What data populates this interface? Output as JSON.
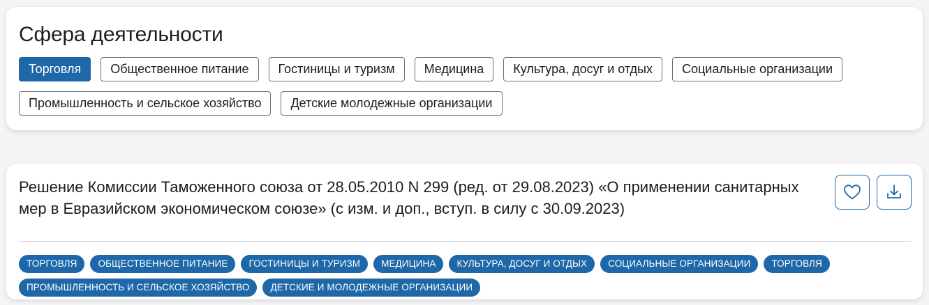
{
  "filter": {
    "title": "Сфера деятельности",
    "chips": [
      {
        "label": "Торговля",
        "active": true
      },
      {
        "label": "Общественное питание",
        "active": false
      },
      {
        "label": "Гостиницы и туризм",
        "active": false
      },
      {
        "label": "Медицина",
        "active": false
      },
      {
        "label": "Культура, досуг и отдых",
        "active": false
      },
      {
        "label": "Социальные организации",
        "active": false
      },
      {
        "label": "Промышленность и сельское хозяйство",
        "active": false
      },
      {
        "label": "Детские молодежные организации",
        "active": false
      }
    ]
  },
  "document": {
    "title": "Решение Комиссии Таможенного союза от 28.05.2010 N 299 (ред. от 29.08.2023) «О применении санитарных мер в Евразийском экономическом союзе» (с изм. и доп., вступ. в силу с 30.09.2023)",
    "actions": {
      "favorite_icon": "heart-icon",
      "download_icon": "download-icon"
    },
    "tags": [
      "ТОРГОВЛЯ",
      "ОБЩЕСТВЕННОЕ ПИТАНИЕ",
      "ГОСТИНИЦЫ И ТУРИЗМ",
      "МЕДИЦИНА",
      "КУЛЬТУРА, ДОСУГ И ОТДЫХ",
      "СОЦИАЛЬНЫЕ ОРГАНИЗАЦИИ",
      "ТОРГОВЛЯ",
      "ПРОМЫШЛЕННОСТЬ И СЕЛЬСКОЕ ХОЗЯЙСТВО",
      "ДЕТСКИЕ И МОЛОДЕЖНЫЕ ОРГАНИЗАЦИИ"
    ]
  },
  "colors": {
    "accent": "#1e67a8",
    "chip_border": "#6e6e73",
    "text": "#1d1d1f",
    "background": "#f5f5f7"
  }
}
